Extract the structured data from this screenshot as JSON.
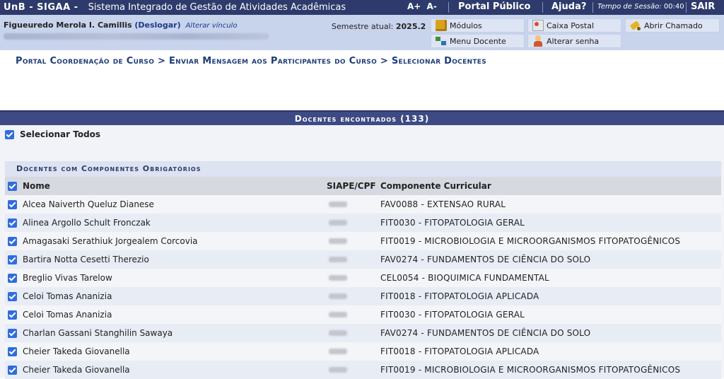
{
  "topbar": {
    "brand": "UnB - SIGAA -",
    "system_name": "Sistema Integrado de Gestão de Atividades Acadêmicas",
    "font_increase": "A+",
    "font_decrease": "A-",
    "portal_publico": "Portal Público",
    "ajuda": "Ajuda?",
    "session_label": "Tempo de Sessão:",
    "session_time": "00:40",
    "logout": "SAIR"
  },
  "user": {
    "name": "Figueuredo Merola I. Camillis",
    "deslogar": "(Deslogar)",
    "alterar_vinculo": "Alterar vínculo",
    "semestre_label": "Semestre atual:",
    "semestre_value": "2025.2"
  },
  "buttons": {
    "modulos": "Módulos",
    "caixa_postal": "Caixa Postal",
    "abrir_chamado": "Abrir Chamado",
    "menu_docente": "Menu Docente",
    "alterar_senha": "Alterar senha"
  },
  "breadcrumb": "Portal Coordenação de Curso > Enviar Mensagem aos Participantes do Curso > Selecionar Docentes",
  "results": {
    "caption": "Docentes encontrados (133)",
    "select_all_label": "Selecionar Todos",
    "section_title": "Docentes com Componentes Obrigatórios",
    "columns": {
      "nome": "Nome",
      "siape": "SIAPE/CPF",
      "componente": "Componente Curricular"
    },
    "rows": [
      {
        "nome": "Alcea Naiverth Queluz Dianese",
        "componente": "FAV0088 - EXTENSAO RURAL"
      },
      {
        "nome": "Alinea Argollo Schult Fronczak",
        "componente": "FIT0030 - FITOPATOLOGIA GERAL"
      },
      {
        "nome": "Amagasaki Serathiuk Jorgealem Corcovia",
        "componente": "FIT0019 - MICROBIOLOGIA E MICROORGANISMOS FITOPATOGÊNICOS"
      },
      {
        "nome": "Bartira Notta Cesetti Therezio",
        "componente": "FAV0274 - FUNDAMENTOS DE CIÊNCIA DO SOLO"
      },
      {
        "nome": "Breglio Vivas Tarelow",
        "componente": "CEL0054 - BIOQUIMICA FUNDAMENTAL"
      },
      {
        "nome": "Celoi Tomas Ananizia",
        "componente": "FIT0018 - FITOPATOLOGIA APLICADA"
      },
      {
        "nome": "Celoi Tomas Ananizia",
        "componente": "FIT0030 - FITOPATOLOGIA GERAL"
      },
      {
        "nome": "Charlan Gassani Stanghilin Sawaya",
        "componente": "FAV0274 - FUNDAMENTOS DE CIÊNCIA DO SOLO"
      },
      {
        "nome": "Cheier Takeda Giovanella",
        "componente": "FIT0018 - FITOPATOLOGIA APLICADA"
      },
      {
        "nome": "Cheier Takeda Giovanella",
        "componente": "FIT0019 - MICROBIOLOGIA E MICROORGANISMOS FITOPATOGÊNICOS"
      }
    ]
  },
  "colors": {
    "topbar_bg": "#2d3a6b",
    "panel_bg": "#c8d3ec",
    "caption_bg": "#3d4a84",
    "breadcrumb": "#1f3d7a",
    "checkbox": "#2f6ddc"
  }
}
